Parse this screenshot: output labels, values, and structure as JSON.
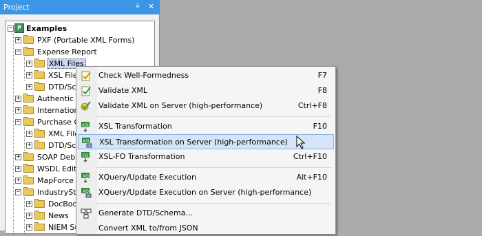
{
  "panel": {
    "title": "Project",
    "pin_glyph": "⩯",
    "close_glyph": "✕"
  },
  "tree": {
    "root": "Examples",
    "items": [
      {
        "label": "PXF (Portable XML Forms)"
      },
      {
        "label": "Expense Report"
      },
      {
        "label": "XML Files"
      },
      {
        "label": "XSL Files"
      },
      {
        "label": "DTD/Sche"
      },
      {
        "label": "Authentic S"
      },
      {
        "label": "Internationa"
      },
      {
        "label": "Purchase O"
      },
      {
        "label": "XML Files"
      },
      {
        "label": "DTD/Sche"
      },
      {
        "label": "SOAP Debu"
      },
      {
        "label": "WSDL Edito"
      },
      {
        "label": "MapForce"
      },
      {
        "label": "IndustrySta"
      },
      {
        "label": "DocBook"
      },
      {
        "label": "News"
      },
      {
        "label": "NIEM Sub"
      }
    ]
  },
  "context_menu": {
    "items": [
      {
        "label": "Check Well-Formedness",
        "shortcut": "F7",
        "icon": "check-wellformed-icon"
      },
      {
        "label": "Validate XML",
        "shortcut": "F8",
        "icon": "validate-icon"
      },
      {
        "label": "Validate XML on Server (high-performance)",
        "shortcut": "Ctrl+F8",
        "icon": "validate-server-icon"
      },
      {
        "label": "XSL Transformation",
        "shortcut": "F10",
        "icon": "xsl-icon"
      },
      {
        "label": "XSL Transformation on Server (high-performance)",
        "shortcut": "",
        "icon": "xsl-server-icon"
      },
      {
        "label": "XSL-FO Transformation",
        "shortcut": "Ctrl+F10",
        "icon": "fo-icon"
      },
      {
        "label": "XQuery/Update Execution",
        "shortcut": "Alt+F10",
        "icon": "xq-icon"
      },
      {
        "label": "XQuery/Update Execution on Server (high-performance)",
        "shortcut": "",
        "icon": "xq-server-icon"
      },
      {
        "label": "Generate DTD/Schema...",
        "shortcut": "",
        "icon": "generate-schema-icon"
      },
      {
        "label": "Convert XML to/from JSON",
        "shortcut": "",
        "icon": ""
      }
    ],
    "highlight_color": "#d5e4f7"
  }
}
